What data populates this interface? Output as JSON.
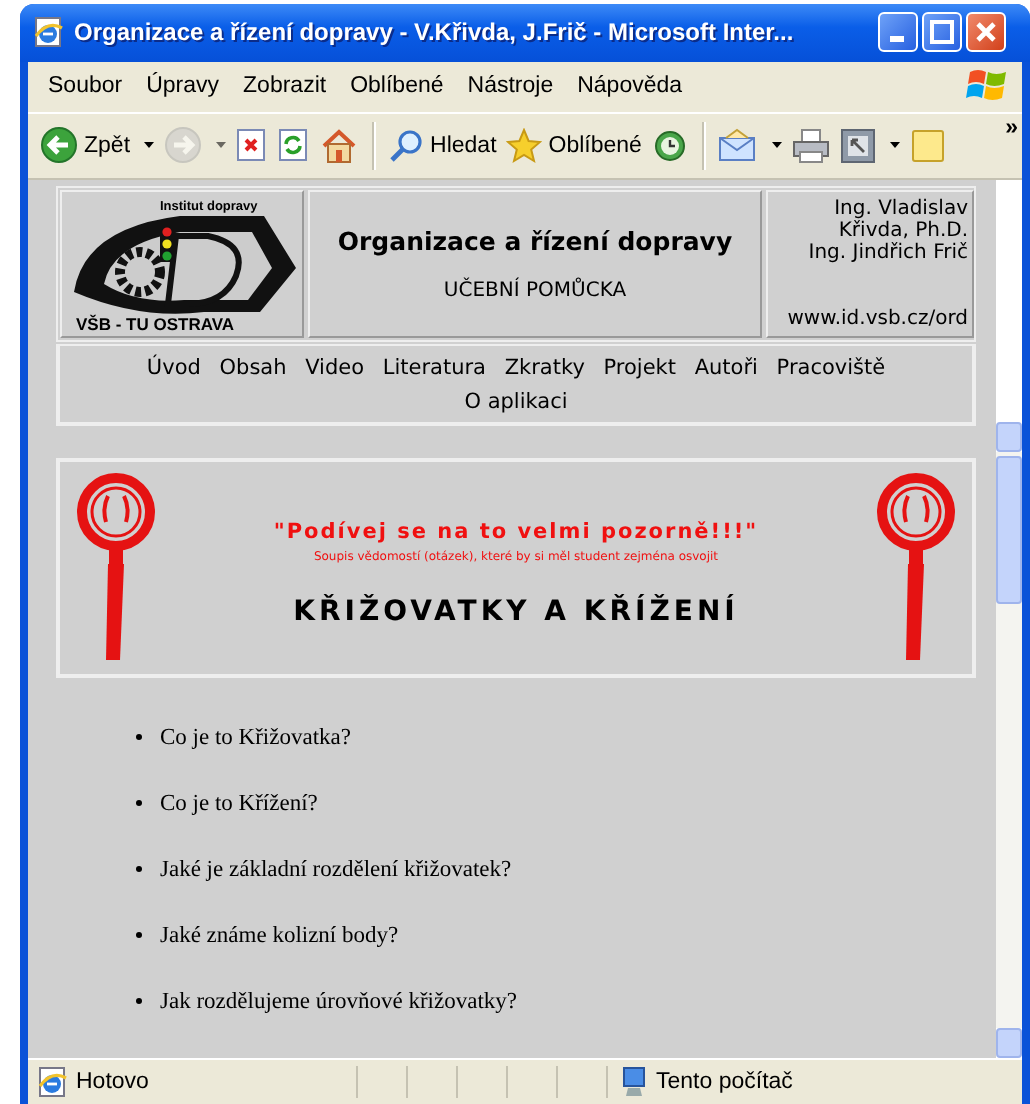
{
  "window": {
    "title": "Organizace a řízení dopravy - V.Křivda, J.Frič - Microsoft Inter..."
  },
  "menu": [
    "Soubor",
    "Úpravy",
    "Zobrazit",
    "Oblíbené",
    "Nástroje",
    "Nápověda"
  ],
  "toolbar": [
    {
      "kind": "back",
      "label": "Zpět",
      "dropdown": true,
      "disabled": false
    },
    {
      "kind": "forward",
      "dropdown": true,
      "disabled": true
    },
    {
      "kind": "stop",
      "dropdown": false,
      "disabled": false
    },
    {
      "kind": "refresh",
      "dropdown": false,
      "disabled": false
    },
    {
      "kind": "home",
      "dropdown": false,
      "disabled": false
    },
    {
      "kind": "separator"
    },
    {
      "kind": "search",
      "label": "Hledat",
      "dropdown": false,
      "disabled": false
    },
    {
      "kind": "favorites",
      "label": "Oblíbené",
      "dropdown": false,
      "disabled": false
    },
    {
      "kind": "history",
      "dropdown": false,
      "disabled": false
    },
    {
      "kind": "separator"
    },
    {
      "kind": "mail",
      "dropdown": true,
      "disabled": false
    },
    {
      "kind": "print",
      "dropdown": false,
      "disabled": false
    },
    {
      "kind": "edit",
      "dropdown": true,
      "disabled": false
    },
    {
      "kind": "note",
      "dropdown": false,
      "disabled": false
    }
  ],
  "toolbar_more": "»",
  "header": {
    "logo_top": "Institut dopravy",
    "logo_bottom": "VŠB - TU OSTRAVA",
    "title": "Organizace a řízení dopravy",
    "subtitle": "UČEBNÍ POMŮCKA",
    "authors": [
      "Ing. Vladislav",
      "Křivda, Ph.D.",
      "Ing. Jindřich Frič"
    ],
    "url": "www.id.vsb.cz/ord"
  },
  "nav": [
    "Úvod",
    "Obsah",
    "Video",
    "Literatura",
    "Zkratky",
    "Projekt",
    "Autoři",
    "Pracoviště",
    "O aplikaci"
  ],
  "banner": {
    "quote": "\"Podívej se na to velmi pozorně!!!\"",
    "note": "Soupis vědomostí (otázek), které by si měl student zejména osvojit",
    "heading": "KŘIŽOVATKY A KŘÍŽENÍ"
  },
  "topics": [
    "Co je to Křižovatka?",
    "Co je to Křížení?",
    "Jaké je základní rozdělení křižovatek?",
    "Jaké známe kolizní body?",
    "Jak rozdělujeme úrovňové křižovatky?"
  ],
  "status": {
    "text": "Hotovo",
    "zone": "Tento počítač"
  }
}
